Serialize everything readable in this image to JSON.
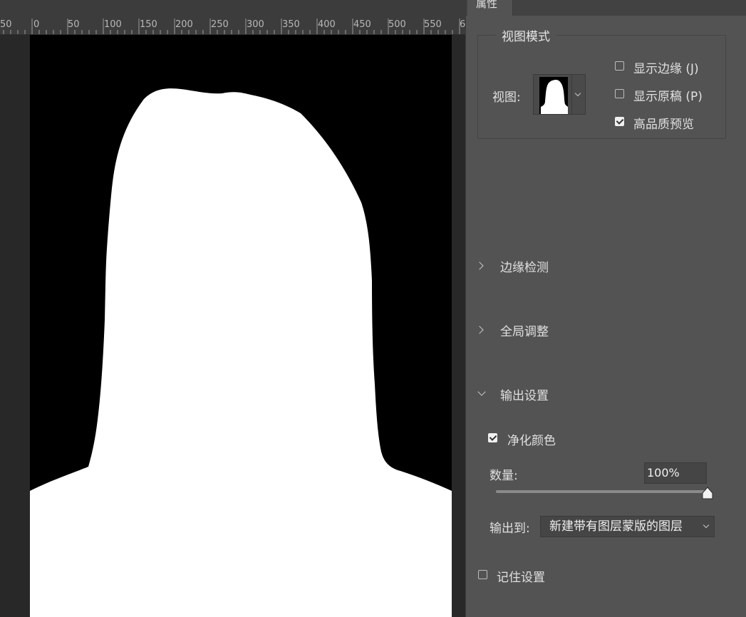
{
  "ruler": {
    "labels": [
      "50",
      "0",
      "50",
      "100",
      "150",
      "200",
      "250",
      "300",
      "350",
      "400",
      "450",
      "500",
      "550",
      "6"
    ]
  },
  "panel": {
    "tab_label": "属性",
    "view_mode": {
      "legend": "视图模式",
      "view_label": "视图:",
      "options": [
        {
          "label": "显示边缘 (J)",
          "checked": false
        },
        {
          "label": "显示原稿 (P)",
          "checked": false
        },
        {
          "label": "高品质预览",
          "checked": true
        }
      ]
    },
    "sections": {
      "edge_detection": {
        "label": "边缘检测",
        "expanded": false
      },
      "global_refine": {
        "label": "全局调整",
        "expanded": false
      },
      "output_settings": {
        "label": "输出设置",
        "expanded": true
      }
    },
    "output": {
      "decontaminate_label": "净化颜色",
      "decontaminate_checked": true,
      "amount_label": "数量:",
      "amount_value": "100%",
      "amount_fraction": 1.0,
      "output_to_label": "输出到:",
      "output_to_value": "新建带有图层蒙版的图层"
    },
    "remember_label": "记住设置",
    "remember_checked": false
  },
  "colors": {
    "panel_bg": "#535353",
    "canvas_bg": "#282828",
    "mask_fg": "#ffffff",
    "mask_bg": "#000000"
  }
}
